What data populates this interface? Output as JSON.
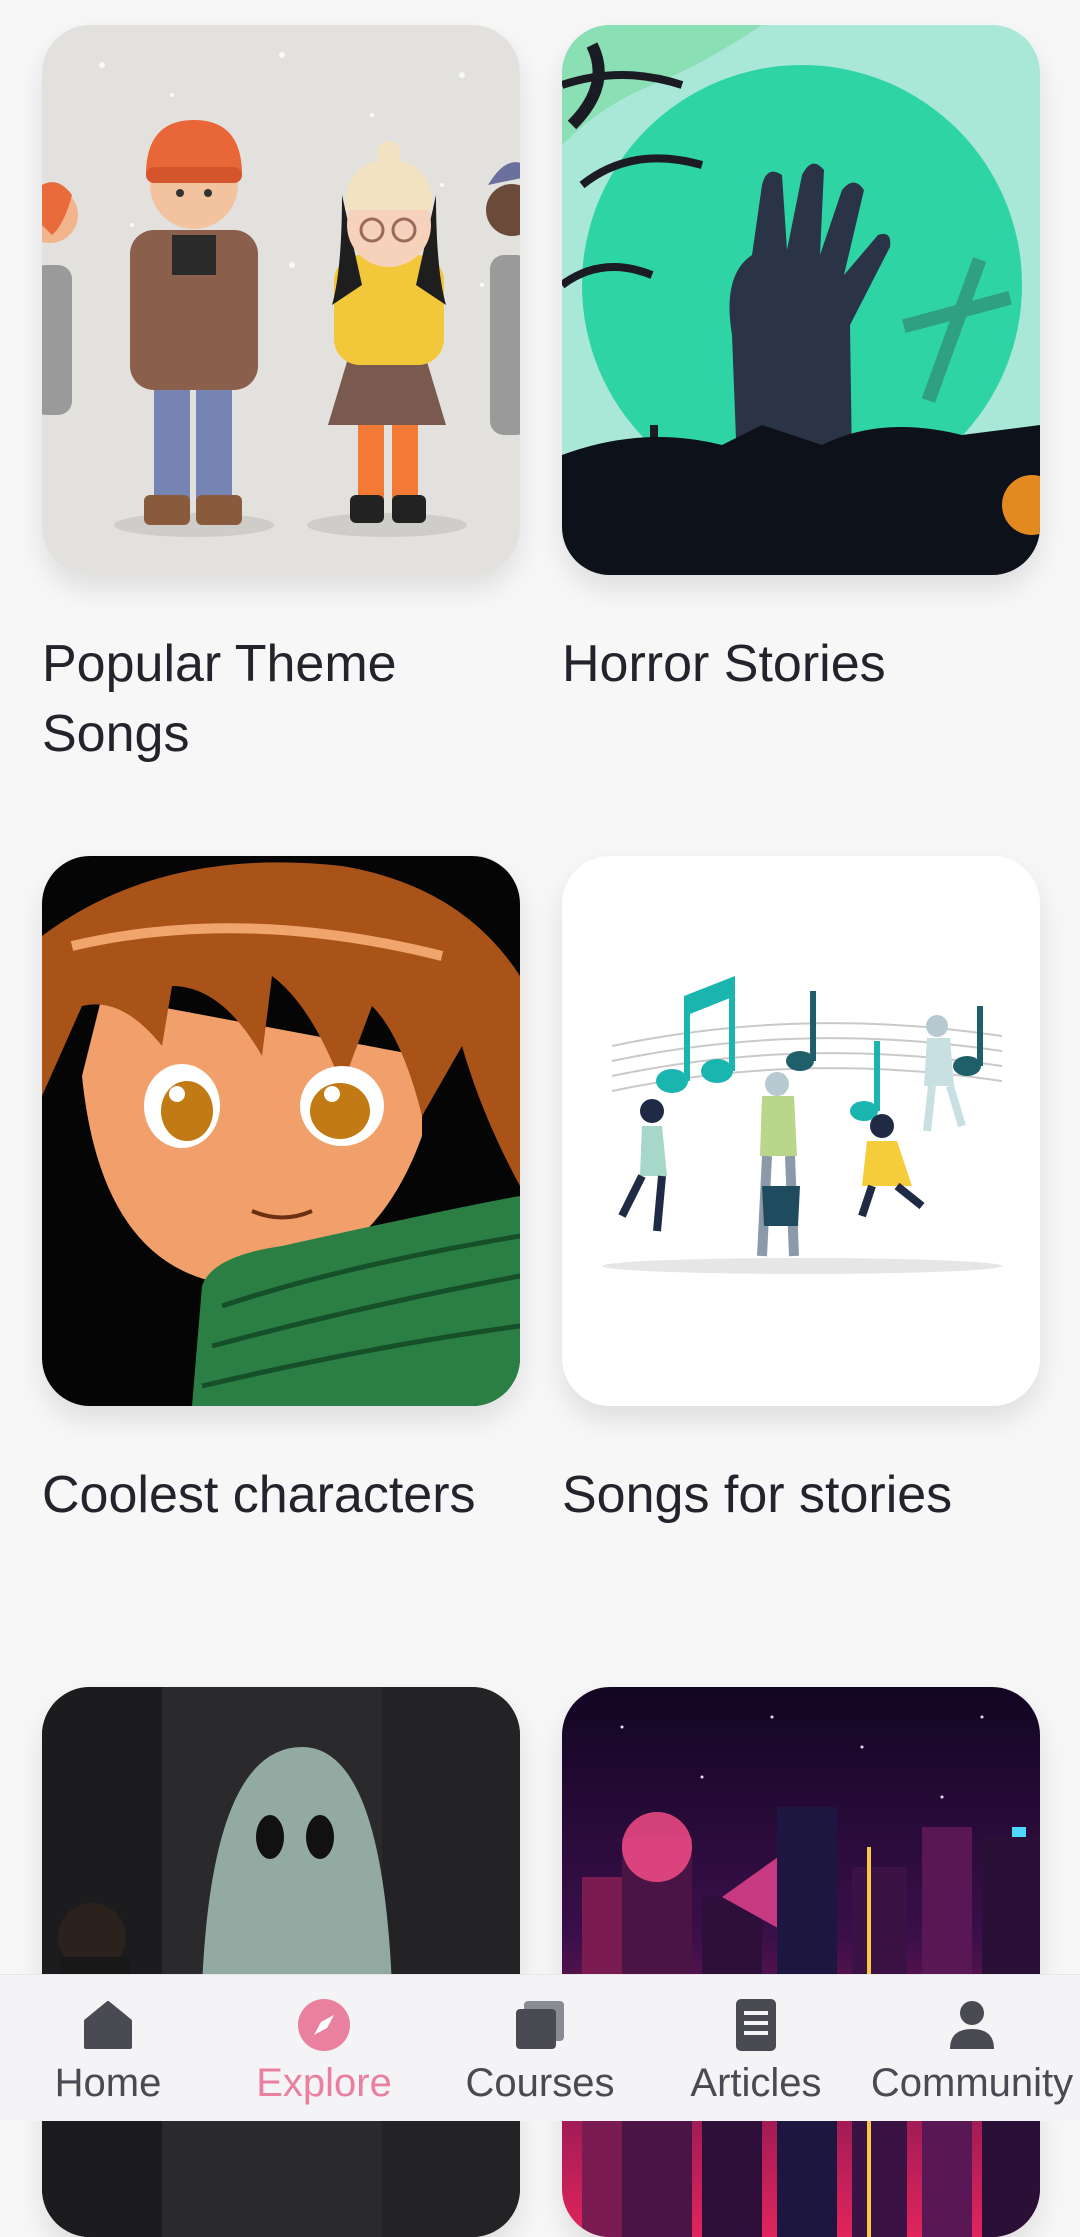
{
  "cards": [
    {
      "title": "Popular Theme Songs",
      "image": "winter-friends-illustration"
    },
    {
      "title": "Horror Stories",
      "image": "zombie-hand-graveyard-illustration"
    },
    {
      "title": "Coolest characters",
      "image": "anime-boy-illustration"
    },
    {
      "title": "Songs for stories",
      "image": "people-dancing-music-notes-illustration"
    },
    {
      "title": "",
      "image": "ghost-illustration"
    },
    {
      "title": "",
      "image": "neon-city-skyline-illustration"
    }
  ],
  "nav": {
    "home": {
      "label": "Home",
      "icon": "home-icon"
    },
    "explore": {
      "label": "Explore",
      "icon": "compass-icon",
      "active": true
    },
    "courses": {
      "label": "Courses",
      "icon": "stack-icon"
    },
    "articles": {
      "label": "Articles",
      "icon": "document-icon"
    },
    "community": {
      "label": "Community",
      "icon": "person-icon"
    }
  },
  "colors": {
    "accent": "#e8809e",
    "text": "#23232b",
    "background": "#f7f7f8"
  }
}
